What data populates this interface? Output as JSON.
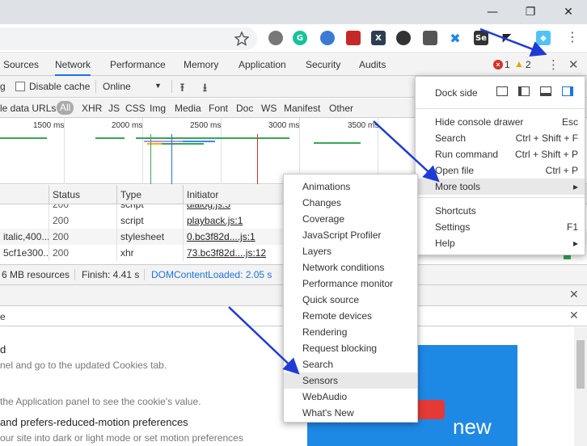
{
  "window": {
    "minimize": "—",
    "maximize": "❐",
    "close": "✕"
  },
  "toolbar": {
    "extensions": [
      "G",
      "S",
      "Se"
    ]
  },
  "panel_tabs": [
    "Sources",
    "Network",
    "Performance",
    "Memory",
    "Application",
    "Security",
    "Audits"
  ],
  "status_counts": {
    "errors": "1",
    "warnings": "2"
  },
  "net_toolbar": {
    "preserve_log_fragment": "g",
    "disable_cache": "Disable cache",
    "throttle": "Online",
    "throttle_arrow": "▼"
  },
  "filter_bar": {
    "hide_data_urls": "le data URLs",
    "types": [
      "All",
      "XHR",
      "JS",
      "CSS",
      "Img",
      "Media",
      "Font",
      "Doc",
      "WS",
      "Manifest",
      "Other"
    ]
  },
  "overview": {
    "ticks": [
      "1500 ms",
      "2000 ms",
      "2500 ms",
      "3000 ms",
      "3500 ms"
    ]
  },
  "table": {
    "headers": [
      "Status",
      "Type",
      "Initiator"
    ],
    "rows": [
      {
        "name": "",
        "status": "200",
        "type": "script",
        "initiator": "playback.js:1"
      },
      {
        "name": "italic,400...",
        "status": "200",
        "type": "stylesheet",
        "initiator": "0.bc3f82d....js:1"
      },
      {
        "name": "5cf1e300...",
        "status": "200",
        "type": "xhr",
        "initiator": "73.bc3f82d....js:12"
      }
    ],
    "partial_top_row": {
      "status": "200",
      "type": "script",
      "initiator": "dialog.js:5"
    }
  },
  "statusbar": {
    "resources": "6 MB resources",
    "finish": "Finish: 4.41 s",
    "dcl": "DOMContentLoaded: 2.05 s"
  },
  "drawer": {
    "tab_fragment": "e",
    "lines": [
      {
        "text": "d",
        "style": "heading"
      },
      {
        "text": "nel and go to the updated Cookies tab.",
        "style": "muted"
      },
      {
        "text": "the Application panel to see the cookie's value.",
        "style": "muted"
      },
      {
        "text": "and prefers-reduced-motion preferences",
        "style": "heading"
      },
      {
        "text": "our site into dark or light mode or set motion preferences",
        "style": "muted"
      }
    ],
    "promo_text": "new"
  },
  "main_menu": {
    "dock_side_label": "Dock side",
    "items": [
      {
        "label": "Hide console drawer",
        "shortcut": "Esc"
      },
      {
        "label": "Search",
        "shortcut": "Ctrl + Shift + F"
      },
      {
        "label": "Run command",
        "shortcut": "Ctrl + Shift + P"
      },
      {
        "label": "Open file",
        "shortcut": "Ctrl + P"
      },
      {
        "label": "More tools",
        "shortcut": "▸"
      },
      {
        "label": "Shortcuts",
        "shortcut": ""
      },
      {
        "label": "Settings",
        "shortcut": "F1"
      },
      {
        "label": "Help",
        "shortcut": "▸"
      }
    ]
  },
  "more_tools_menu": {
    "items": [
      "Animations",
      "Changes",
      "Coverage",
      "JavaScript Profiler",
      "Layers",
      "Network conditions",
      "Performance monitor",
      "Quick source",
      "Remote devices",
      "Rendering",
      "Request blocking",
      "Search",
      "Sensors",
      "WebAudio",
      "What's New"
    ],
    "highlighted": "Sensors"
  },
  "colors": {
    "accent": "#1a73e8",
    "arrow": "#1f3bd6",
    "error": "#d93025",
    "warning": "#e8a400",
    "promo": "#1e88e5"
  }
}
